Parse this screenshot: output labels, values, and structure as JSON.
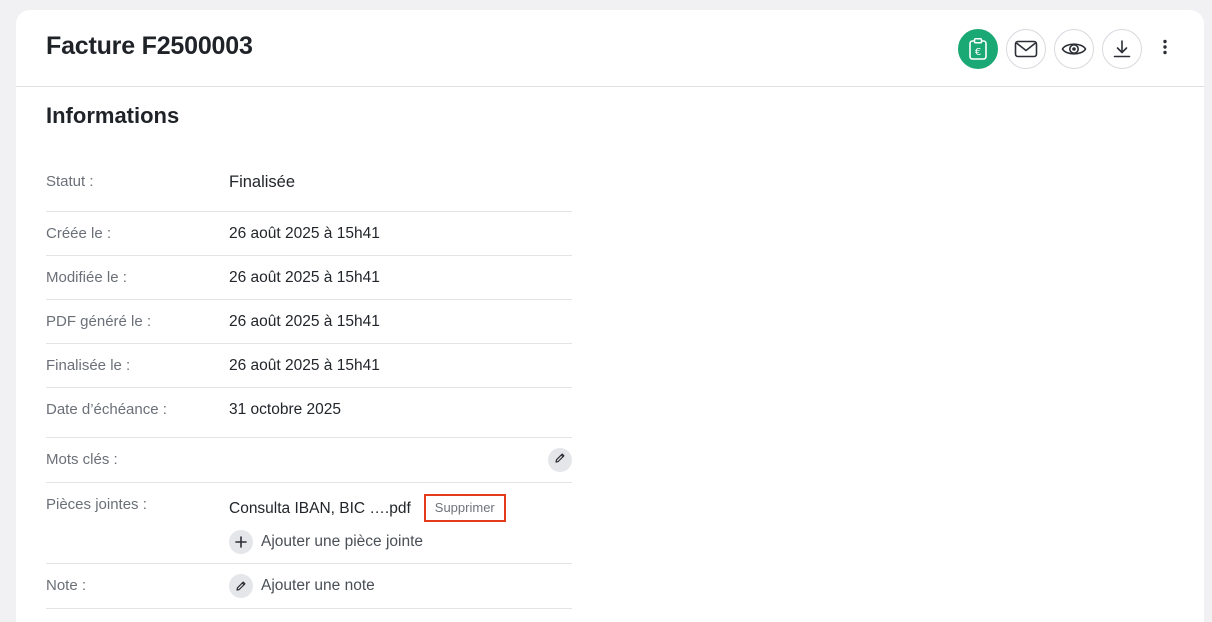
{
  "header": {
    "title": "Facture F2500003",
    "actions": [
      {
        "icon": "clipboard-euro-icon",
        "label": "€"
      },
      {
        "icon": "envelope-icon"
      },
      {
        "icon": "eye-icon"
      },
      {
        "icon": "download-icon"
      },
      {
        "icon": "more-vertical-icon"
      }
    ],
    "accent_color": "#1aa874"
  },
  "informations": {
    "title": "Informations",
    "status": {
      "label": "Statut :",
      "value": "Finalisée"
    },
    "created": {
      "label": "Créée le :",
      "value": "26 août 2025 à 15h41"
    },
    "modified": {
      "label": "Modifiée le :",
      "value": "26 août 2025 à 15h41"
    },
    "pdf_generated": {
      "label": "PDF généré le :",
      "value": "26 août 2025 à 15h41"
    },
    "finalized": {
      "label": "Finalisée le :",
      "value": "26 août 2025 à 15h41"
    },
    "due_date": {
      "label": "Date d’échéance :",
      "value": "31 octobre 2025"
    },
    "keywords": {
      "label": "Mots clés :",
      "icon": "pencil-icon"
    },
    "attachments": {
      "label": "Pièces jointes :",
      "files": [
        {
          "name": "Consulta IBAN, BIC ….pdf",
          "delete_label": "Supprimer"
        }
      ],
      "add_label": "Ajouter une pièce jointe",
      "add_icon": "plus-icon"
    },
    "note": {
      "label": "Note :",
      "add_label": "Ajouter une note",
      "icon": "pencil-icon"
    }
  },
  "colors": {
    "delete_highlight": "#e23b1b",
    "label": "#6b7078"
  }
}
